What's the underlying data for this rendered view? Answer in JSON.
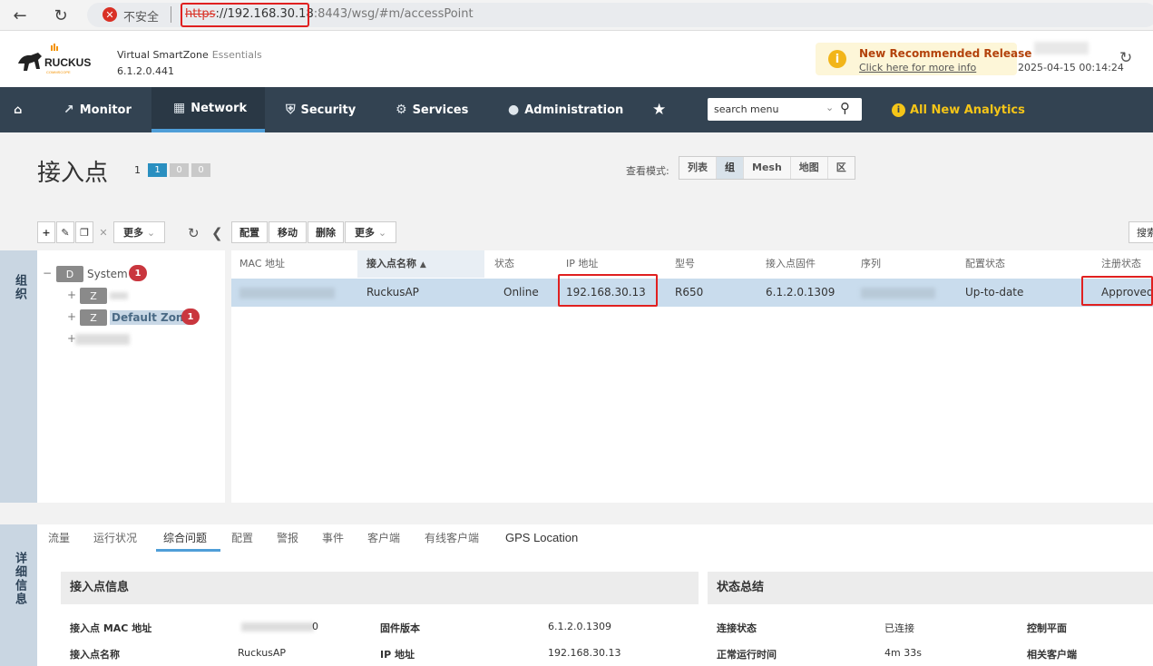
{
  "browser": {
    "insecure_label": "不安全",
    "url_scheme": "https",
    "url_sep": "://",
    "url_host": "192.168.30.18",
    "url_rest": ":8443/wsg/#m/accessPoint"
  },
  "header": {
    "product": "Virtual SmartZone",
    "edition": "Essentials",
    "version": "6.1.2.0.441",
    "release_title": "New Recommended Release",
    "release_link": "Click here for more info",
    "datetime": "2025-04-15  00:14:24"
  },
  "nav": {
    "monitor": "Monitor",
    "network": "Network",
    "security": "Security",
    "services": "Services",
    "administration": "Administration",
    "search_placeholder": "search menu",
    "analytics": "All New Analytics"
  },
  "page": {
    "title": "接入点",
    "count_plain": "1",
    "counts": [
      "1",
      "0",
      "0"
    ],
    "count_colors": [
      "#2a8fc0",
      "#c9c9c9",
      "#c9c9c9"
    ],
    "view_label": "查看模式:",
    "views": [
      "列表",
      "组",
      "Mesh",
      "地图",
      "区"
    ],
    "selected_view": "组"
  },
  "toolbar": {
    "tree_more": "更多",
    "configure": "配置",
    "move": "移动",
    "delete": "删除",
    "more": "更多",
    "search": "搜索"
  },
  "side_labels": {
    "group": "组织",
    "details": "详细信息"
  },
  "tree": {
    "system": {
      "badge": "D",
      "label": "System",
      "count": "1"
    },
    "zone1": {
      "badge": "Z"
    },
    "zone2": {
      "badge": "Z",
      "label": "Default Zone",
      "count": "1"
    }
  },
  "table": {
    "headers": [
      "MAC 地址",
      "接入点名称",
      "状态",
      "IP 地址",
      "型号",
      "接入点固件",
      "序列",
      "配置状态",
      "注册状态"
    ],
    "rows": [
      {
        "name": "RuckusAP",
        "status": "Online",
        "ip": "192.168.30.13",
        "model": "R650",
        "firmware": "6.1.2.0.1309",
        "config_status": "Up-to-date",
        "reg_status": "Approved"
      }
    ]
  },
  "details": {
    "tabs": [
      "流量",
      "运行状况",
      "综合问题",
      "配置",
      "警报",
      "事件",
      "客户端",
      "有线客户端",
      "GPS Location"
    ],
    "active_tab": "综合问题",
    "ap_info_title": "接入点信息",
    "status_title": "状态总结",
    "mac_label": "接入点 MAC 地址",
    "mac_suffix": "0",
    "fw_label": "固件版本",
    "fw_value": "6.1.2.0.1309",
    "name_label": "接入点名称",
    "name_value": "RuckusAP",
    "ip_label": "IP 地址",
    "ip_value": "192.168.30.13",
    "conn_label": "连接状态",
    "conn_value": "已连接",
    "uptime_label": "正常运行时间",
    "uptime_value": "4m 33s",
    "control_label": "控制平面",
    "clients_label": "相关客户端"
  }
}
